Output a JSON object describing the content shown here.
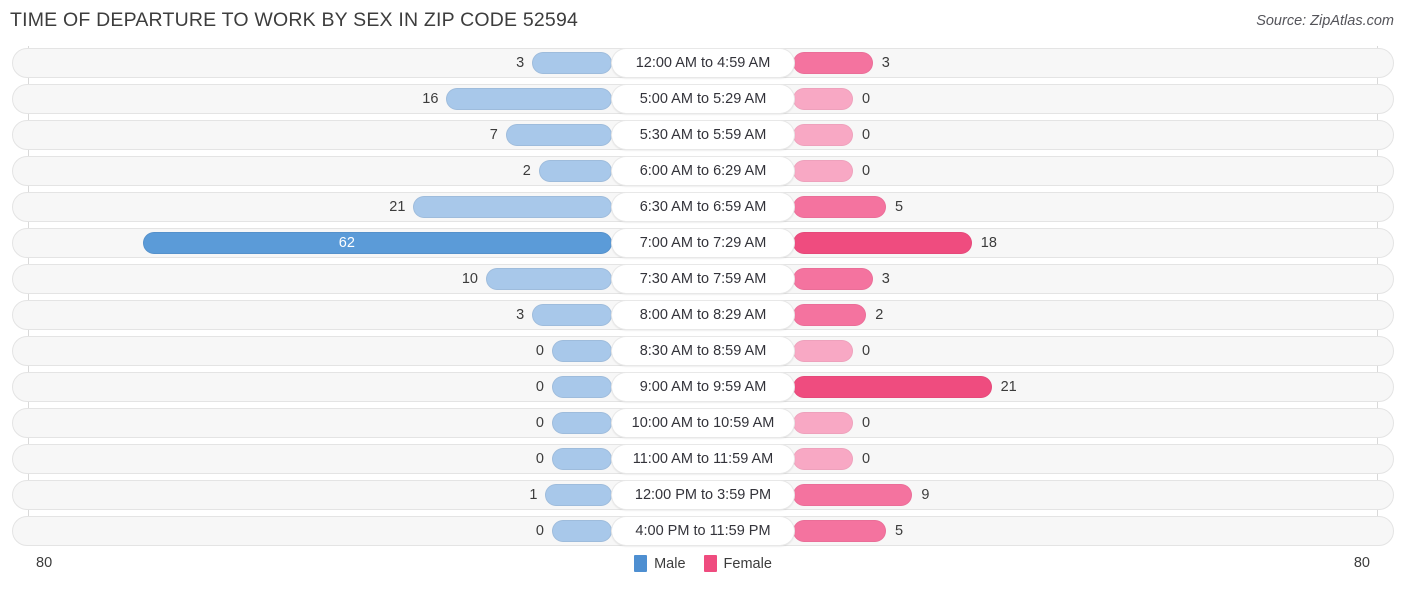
{
  "header": {
    "title": "TIME OF DEPARTURE TO WORK BY SEX IN ZIP CODE 52594",
    "source": "Source: ZipAtlas.com"
  },
  "footer": {
    "axis_max_left": "80",
    "axis_max_right": "80",
    "legend": [
      {
        "label": "Male",
        "color": "#4e8fd1"
      },
      {
        "label": "Female",
        "color": "#ef4c7f"
      }
    ]
  },
  "colors": {
    "male_strong": "#5b9bd8",
    "male_light": "#a8c8ea",
    "female_strong": "#ef4c7f",
    "female_mid": "#f4739f",
    "female_light": "#f8a8c4",
    "track": "#f7f7f7",
    "track_border": "#e4e4e4",
    "axis": "#d9d9d9"
  },
  "chart_data": {
    "type": "bar",
    "subtype": "diverging-bidirectional",
    "title": "TIME OF DEPARTURE TO WORK BY SEX IN ZIP CODE 52594",
    "xlabel": "",
    "ylabel": "",
    "xlim": [
      0,
      80
    ],
    "grid": false,
    "legend_position": "bottom-center",
    "categories": [
      "12:00 AM to 4:59 AM",
      "5:00 AM to 5:29 AM",
      "5:30 AM to 5:59 AM",
      "6:00 AM to 6:29 AM",
      "6:30 AM to 6:59 AM",
      "7:00 AM to 7:29 AM",
      "7:30 AM to 7:59 AM",
      "8:00 AM to 8:29 AM",
      "8:30 AM to 8:59 AM",
      "9:00 AM to 9:59 AM",
      "10:00 AM to 10:59 AM",
      "11:00 AM to 11:59 AM",
      "12:00 PM to 3:59 PM",
      "4:00 PM to 11:59 PM"
    ],
    "series": [
      {
        "name": "Male",
        "direction": "left",
        "values": [
          3,
          16,
          7,
          2,
          21,
          62,
          10,
          3,
          0,
          0,
          0,
          0,
          1,
          0
        ]
      },
      {
        "name": "Female",
        "direction": "right",
        "values": [
          3,
          0,
          0,
          0,
          5,
          18,
          3,
          2,
          0,
          21,
          0,
          0,
          9,
          5
        ]
      }
    ]
  }
}
